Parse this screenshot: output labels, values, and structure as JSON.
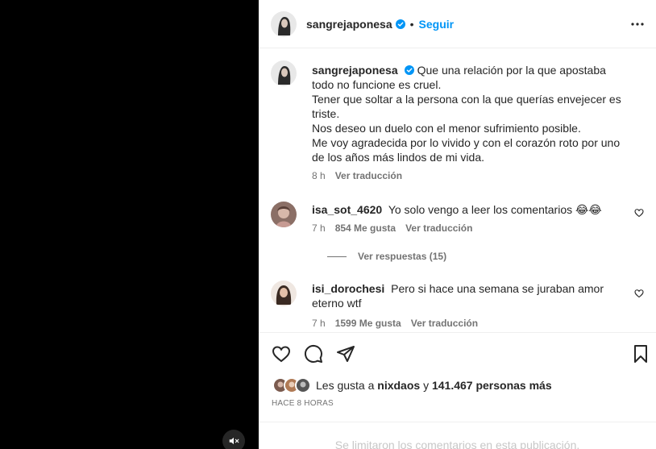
{
  "post": {
    "author": "sangrejaponesa",
    "separator": "•",
    "follow_label": "Seguir"
  },
  "caption": {
    "username": "sangrejaponesa",
    "lines": [
      "Que una relación por la que apostaba todo no funcione es cruel.",
      "Tener que soltar a la persona con la que querías envejecer es triste.",
      "Nos deseo un duelo con el menor sufrimiento posible.",
      "Me voy agradecida por lo vivido y con el corazón roto por uno de los años más lindos de mi vida."
    ],
    "time": "8 h",
    "translate": "Ver traducción"
  },
  "comments": [
    {
      "username": "isa_sot_4620",
      "text": "Yo solo vengo a leer los comentarios 😂😂",
      "time": "7 h",
      "likes": "854 Me gusta",
      "translate": "Ver traducción",
      "replies": "Ver respuestas (15)"
    },
    {
      "username": "isi_dorochesi",
      "text": "Pero si hace una semana se juraban amor eterno wtf",
      "time": "7 h",
      "likes": "1599 Me gusta",
      "translate": "Ver traducción"
    }
  ],
  "likes": {
    "prefix": "Les gusta a ",
    "user": "nixdaos",
    "middle": " y ",
    "count": "141.467 personas más"
  },
  "time_ago": "HACE 8 HORAS",
  "limited_notice": "Se limitaron los comentarios en esta publicación.",
  "icons": {
    "verified": "verified-badge-icon",
    "more": "more-options-icon",
    "like": "heart-icon",
    "comment": "comment-bubble-icon",
    "share": "paper-plane-icon",
    "save": "bookmark-icon",
    "mute": "speaker-muted-icon"
  },
  "colors": {
    "follow": "#0095f6",
    "verified": "#0095f6",
    "secondary_text": "#737373"
  }
}
